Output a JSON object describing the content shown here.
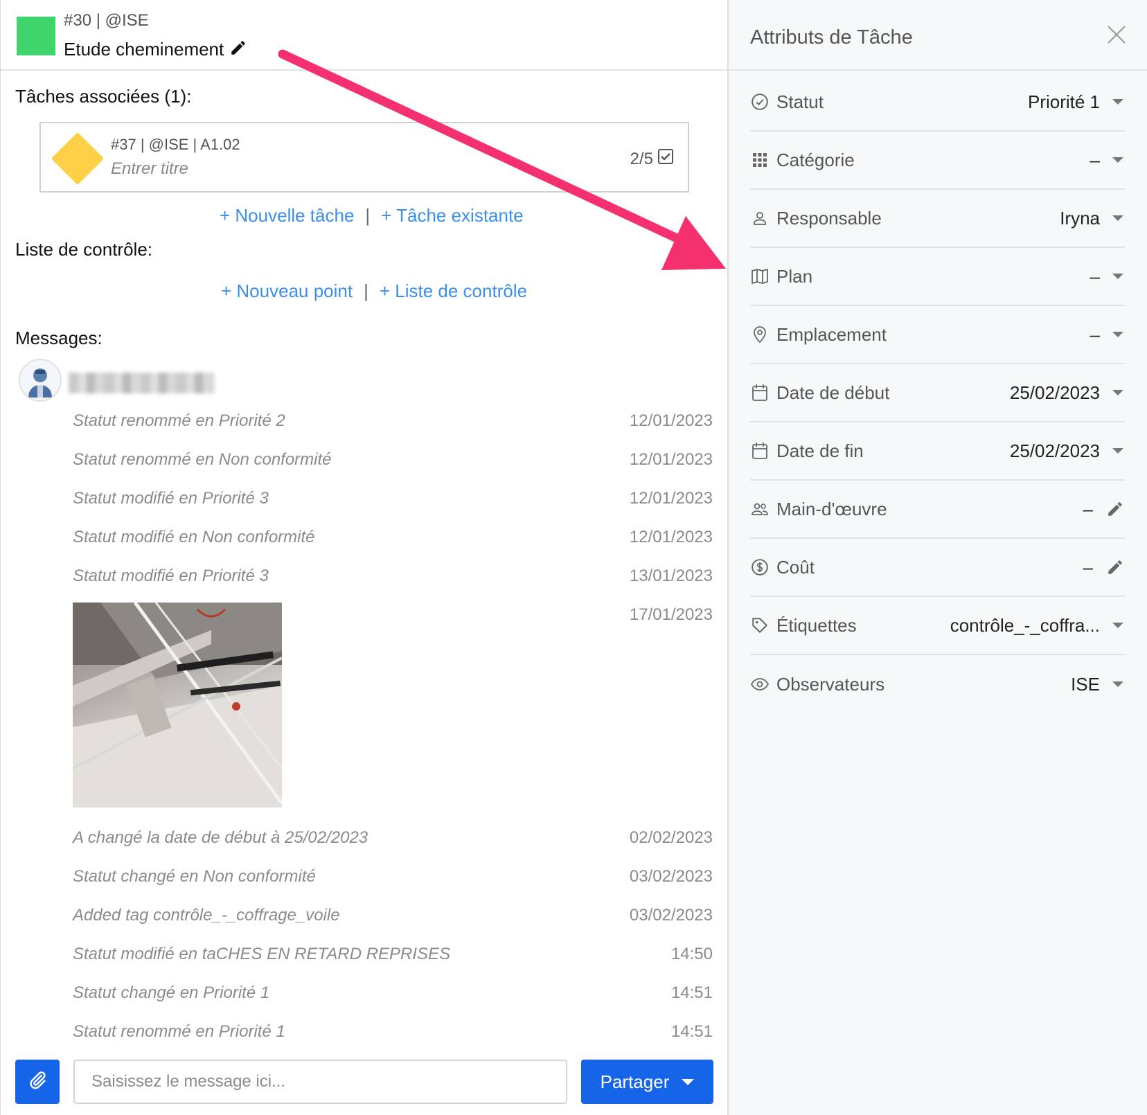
{
  "task": {
    "id_line": "#30 | @ISE",
    "title": "Etude cheminement",
    "color": "#3fd36b"
  },
  "associated": {
    "label": "Tâches associées (1):",
    "subtask": {
      "id_line": "#37 | @ISE | A1.02",
      "title_placeholder": "Entrer titre",
      "count": "2/5",
      "color": "#fdd047"
    },
    "new_task": "+ Nouvelle tâche",
    "existing_task": "+ Tâche existante",
    "separator": "|"
  },
  "checklist": {
    "label": "Liste de contrôle:",
    "new_point": "+ Nouveau point",
    "checklist_link": "+ Liste de contrôle",
    "separator": "|"
  },
  "messages": {
    "label": "Messages:",
    "items": [
      {
        "text": "Statut renommé en Priorité 2",
        "date": "12/01/2023"
      },
      {
        "text": "Statut renommé en Non conformité",
        "date": "12/01/2023"
      },
      {
        "text": "Statut modifié en Priorité 3",
        "date": "12/01/2023"
      },
      {
        "text": "Statut modifié en Non conformité",
        "date": "12/01/2023"
      },
      {
        "text": "Statut modifié en Priorité 3",
        "date": "13/01/2023"
      },
      {
        "text": "",
        "date": "17/01/2023"
      },
      {
        "text": "A changé la date de début à 25/02/2023",
        "date": "02/02/2023"
      },
      {
        "text": "Statut changé en Non conformité",
        "date": "03/02/2023"
      },
      {
        "text": "Added tag contrôle_-_coffrage_voile",
        "date": "03/02/2023"
      },
      {
        "text": "Statut modifié en taCHES EN RETARD REPRISES",
        "date": "14:50"
      },
      {
        "text": "Statut changé en Priorité 1",
        "date": "14:51"
      },
      {
        "text": "Statut renommé en Priorité 1",
        "date": "14:51"
      }
    ]
  },
  "composer": {
    "placeholder": "Saisissez le message ici...",
    "share_label": "Partager"
  },
  "attributes": {
    "title": "Attributs de Tâche",
    "rows": [
      {
        "icon": "check-circle-icon",
        "label": "Statut",
        "value": "Priorité 1",
        "control": "dropdown"
      },
      {
        "icon": "grid-icon",
        "label": "Catégorie",
        "value": "–",
        "control": "dropdown"
      },
      {
        "icon": "person-icon",
        "label": "Responsable",
        "value": "Iryna",
        "control": "dropdown"
      },
      {
        "icon": "map-icon",
        "label": "Plan",
        "value": "–",
        "control": "dropdown"
      },
      {
        "icon": "location-pin-icon",
        "label": "Emplacement",
        "value": "–",
        "control": "dropdown"
      },
      {
        "icon": "calendar-icon",
        "label": "Date de début",
        "value": "25/02/2023",
        "control": "dropdown"
      },
      {
        "icon": "calendar-icon",
        "label": "Date de fin",
        "value": "25/02/2023",
        "control": "dropdown"
      },
      {
        "icon": "people-icon",
        "label": "Main-d'œuvre",
        "value": "–",
        "control": "edit"
      },
      {
        "icon": "dollar-circle-icon",
        "label": "Coût",
        "value": "–",
        "control": "edit"
      },
      {
        "icon": "tag-icon",
        "label": "Étiquettes",
        "value": "contrôle_-_coffra...",
        "control": "dropdown"
      },
      {
        "icon": "eye-icon",
        "label": "Observateurs",
        "value": "ISE",
        "control": "dropdown"
      }
    ]
  },
  "colors": {
    "accent": "#1664e8",
    "link": "#3b8fe8",
    "arrow": "#f4306e"
  }
}
